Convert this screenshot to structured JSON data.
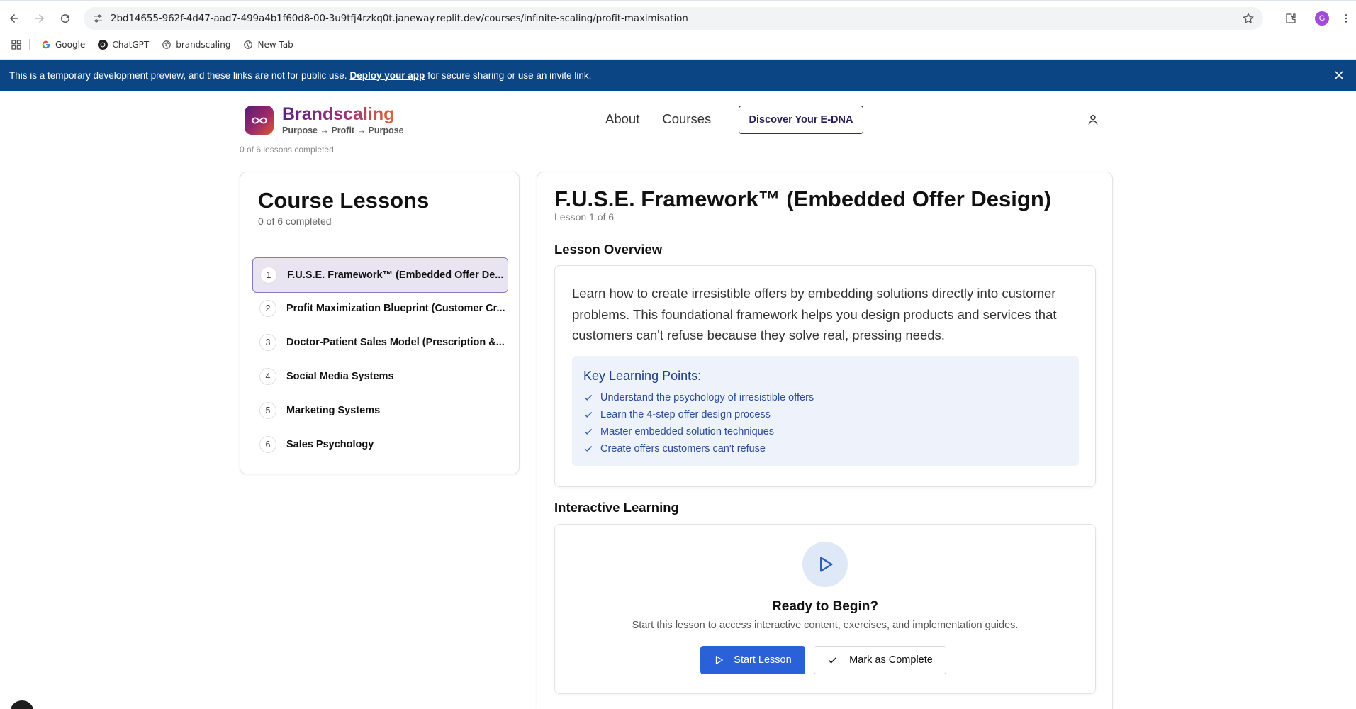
{
  "browser": {
    "url": "2bd14655-962f-4d47-aad7-499a4b1f60d8-00-3u9tfj4rzkq0t.janeway.replit.dev/courses/infinite-scaling/profit-maximisation",
    "profile_initial": "G",
    "bookmarks": [
      {
        "label": "Google",
        "icon": "google-icon"
      },
      {
        "label": "ChatGPT",
        "icon": "chatgpt-icon"
      },
      {
        "label": "brandscaling",
        "icon": "globe-icon"
      },
      {
        "label": "New Tab",
        "icon": "globe-icon"
      }
    ]
  },
  "banner": {
    "text_before": "This is a temporary development preview, and these links are not for public use.",
    "link": "Deploy your app",
    "text_after": "for secure sharing or use an invite link."
  },
  "header": {
    "brand": "Brandscaling",
    "tagline": "Purpose → Profit → Purpose",
    "nav": [
      "About",
      "Courses"
    ],
    "cta": "Discover Your E-DNA"
  },
  "faded_progress": "0 of 6 lessons completed",
  "sidebar": {
    "title": "Course Lessons",
    "progress": "0 of 6 completed",
    "lessons": [
      {
        "num": "1",
        "title": "F.U.S.E. Framework™ (Embedded Offer De...",
        "active": true
      },
      {
        "num": "2",
        "title": "Profit Maximization Blueprint (Customer Cr..."
      },
      {
        "num": "3",
        "title": "Doctor-Patient Sales Model (Prescription &..."
      },
      {
        "num": "4",
        "title": "Social Media Systems"
      },
      {
        "num": "5",
        "title": "Marketing Systems"
      },
      {
        "num": "6",
        "title": "Sales Psychology"
      }
    ]
  },
  "lesson": {
    "title": "F.U.S.E. Framework™ (Embedded Offer Design)",
    "counter": "Lesson 1 of 6",
    "overview_heading": "Lesson Overview",
    "overview_text": "Learn how to create irresistible offers by embedding solutions directly into customer problems. This foundational framework helps you design products and services that customers can't refuse because they solve real, pressing needs.",
    "key_points_title": "Key Learning Points:",
    "key_points": [
      "Understand the psychology of irresistible offers",
      "Learn the 4-step offer design process",
      "Master embedded solution techniques",
      "Create offers customers can't refuse"
    ],
    "interactive_heading": "Interactive Learning",
    "ready_title": "Ready to Begin?",
    "ready_sub": "Start this lesson to access interactive content, exercises, and implementation guides.",
    "start_button": "Start Lesson",
    "complete_button": "Mark as Complete"
  },
  "colors": {
    "banner": "#0b4584",
    "primary": "#2a61d8",
    "active_lesson_bg": "#e9e4f1",
    "key_points_bg": "#eef3fb"
  }
}
